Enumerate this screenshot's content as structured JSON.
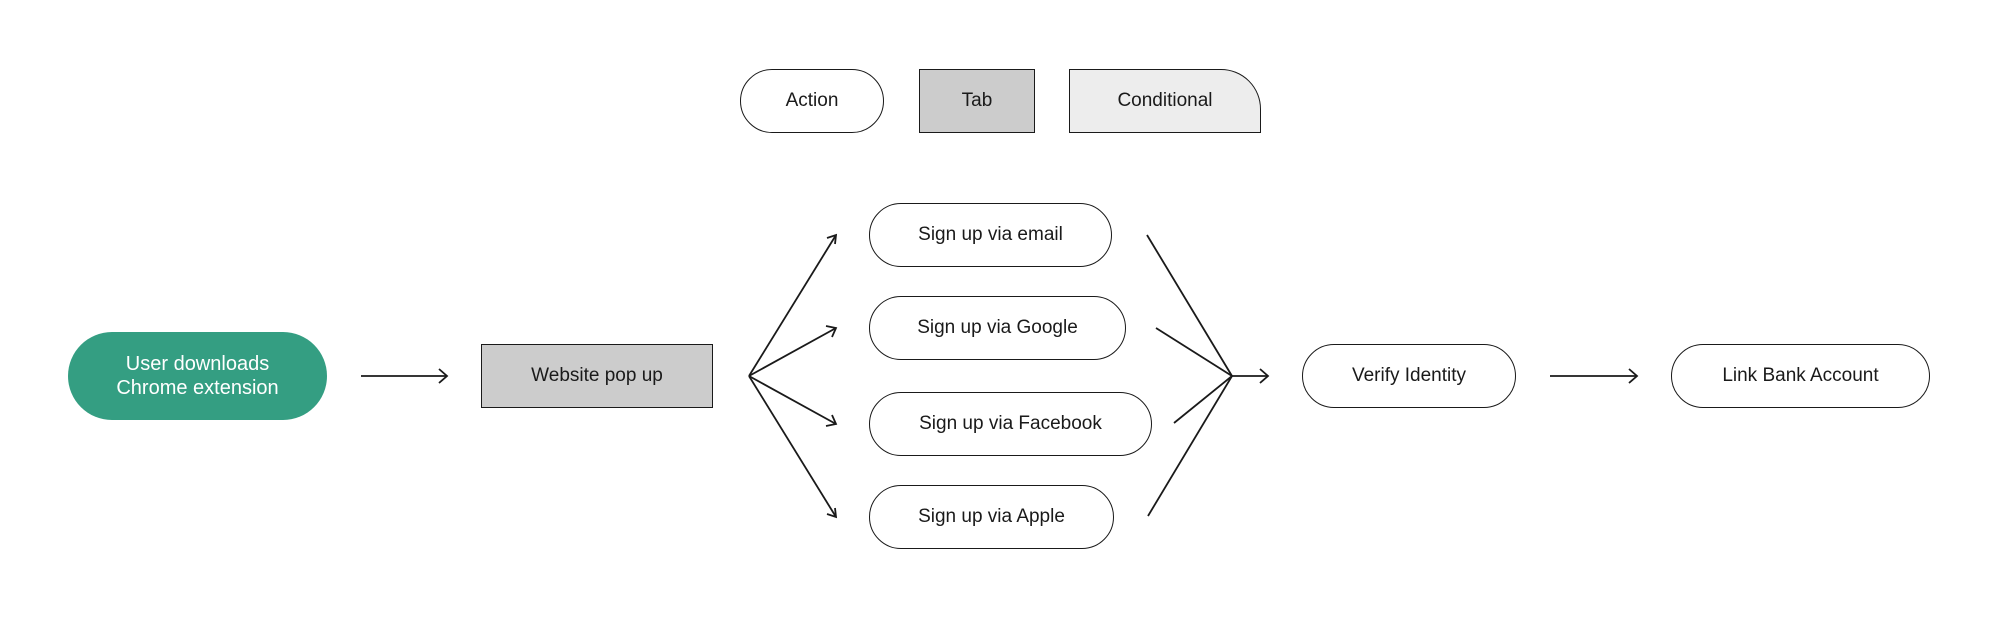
{
  "legend": {
    "action": "Action",
    "tab": "Tab",
    "conditional": "Conditional"
  },
  "colors": {
    "start_fill": "#349e82",
    "tab_fill": "#cccccc",
    "conditional_fill": "#ededed",
    "stroke": "#1a1a1a"
  },
  "flow": {
    "start": {
      "line1": "User downloads",
      "line2": "Chrome extension",
      "type": "start"
    },
    "popup": {
      "label": "Website pop up",
      "type": "tab"
    },
    "signup_options": [
      {
        "label": "Sign up via email",
        "type": "action"
      },
      {
        "label": "Sign up via Google",
        "type": "action"
      },
      {
        "label": "Sign up via Facebook",
        "type": "action"
      },
      {
        "label": "Sign up via Apple",
        "type": "action"
      }
    ],
    "verify": {
      "label": "Verify Identity",
      "type": "action"
    },
    "link_bank": {
      "label": "Link Bank Account",
      "type": "action"
    }
  }
}
